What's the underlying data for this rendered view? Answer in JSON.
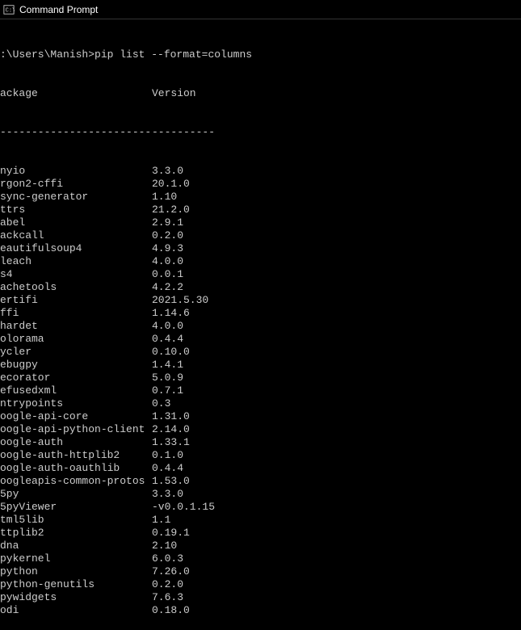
{
  "window": {
    "title": "Command Prompt"
  },
  "prompt": {
    "line": ":\\Users\\Manish>pip list --format=columns"
  },
  "headers": {
    "package": "ackage",
    "version": "Version",
    "sep_package": "------------------------",
    "sep_version": "----------"
  },
  "packages": [
    {
      "name": "nyio",
      "version": "3.3.0"
    },
    {
      "name": "rgon2-cffi",
      "version": "20.1.0"
    },
    {
      "name": "sync-generator",
      "version": "1.10"
    },
    {
      "name": "ttrs",
      "version": "21.2.0"
    },
    {
      "name": "abel",
      "version": "2.9.1"
    },
    {
      "name": "ackcall",
      "version": "0.2.0"
    },
    {
      "name": "eautifulsoup4",
      "version": "4.9.3"
    },
    {
      "name": "leach",
      "version": "4.0.0"
    },
    {
      "name": "s4",
      "version": "0.0.1"
    },
    {
      "name": "achetools",
      "version": "4.2.2"
    },
    {
      "name": "ertifi",
      "version": "2021.5.30"
    },
    {
      "name": "ffi",
      "version": "1.14.6"
    },
    {
      "name": "hardet",
      "version": "4.0.0"
    },
    {
      "name": "olorama",
      "version": "0.4.4"
    },
    {
      "name": "ycler",
      "version": "0.10.0"
    },
    {
      "name": "ebugpy",
      "version": "1.4.1"
    },
    {
      "name": "ecorator",
      "version": "5.0.9"
    },
    {
      "name": "efusedxml",
      "version": "0.7.1"
    },
    {
      "name": "ntrypoints",
      "version": "0.3"
    },
    {
      "name": "oogle-api-core",
      "version": "1.31.0"
    },
    {
      "name": "oogle-api-python-client",
      "version": "2.14.0"
    },
    {
      "name": "oogle-auth",
      "version": "1.33.1"
    },
    {
      "name": "oogle-auth-httplib2",
      "version": "0.1.0"
    },
    {
      "name": "oogle-auth-oauthlib",
      "version": "0.4.4"
    },
    {
      "name": "oogleapis-common-protos",
      "version": "1.53.0"
    },
    {
      "name": "5py",
      "version": "3.3.0"
    },
    {
      "name": "5pyViewer",
      "version": "-v0.0.1.15"
    },
    {
      "name": "tml5lib",
      "version": "1.1"
    },
    {
      "name": "ttplib2",
      "version": "0.19.1"
    },
    {
      "name": "dna",
      "version": "2.10"
    },
    {
      "name": "pykernel",
      "version": "6.0.3"
    },
    {
      "name": "python",
      "version": "7.26.0"
    },
    {
      "name": "python-genutils",
      "version": "0.2.0"
    },
    {
      "name": "pywidgets",
      "version": "7.6.3"
    },
    {
      "name": "odi",
      "version": "0.18.0"
    }
  ]
}
